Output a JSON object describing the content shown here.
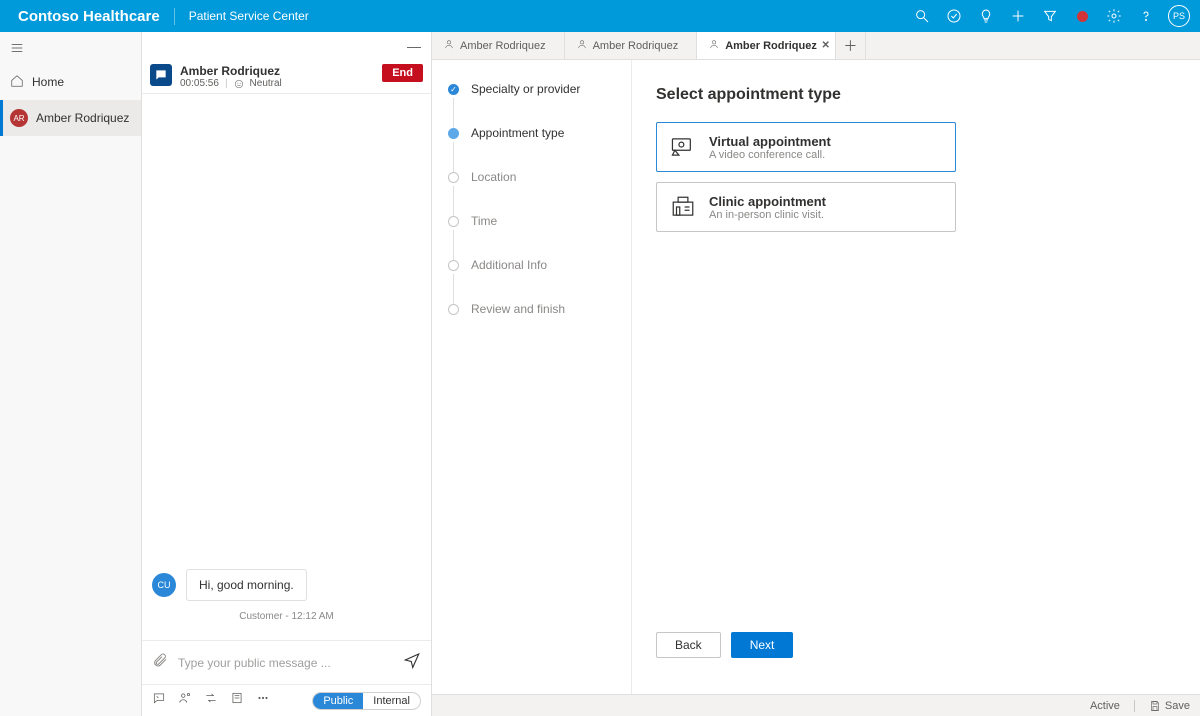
{
  "header": {
    "brand": "Contoso Healthcare",
    "module": "Patient Service Center",
    "avatar_initials": "PS"
  },
  "sidebar": {
    "items": [
      {
        "label": "Home",
        "active": false
      },
      {
        "label": "Amber Rodriquez",
        "active": true,
        "initials": "AR"
      }
    ]
  },
  "conversation": {
    "patient_name": "Amber Rodriquez",
    "duration": "00:05:56",
    "sentiment": "Neutral",
    "end_label": "End",
    "messages": [
      {
        "sender_initials": "CU",
        "text": "Hi, good morning."
      }
    ],
    "meta_line": "Customer - 12:12 AM",
    "composer_placeholder": "Type your public message ...",
    "mode_public": "Public",
    "mode_internal": "Internal"
  },
  "tabs": [
    {
      "label": "Amber Rodriquez",
      "active": false,
      "closable": false
    },
    {
      "label": "Amber Rodriquez",
      "active": false,
      "closable": false
    },
    {
      "label": "Amber Rodriquez",
      "active": true,
      "closable": true
    }
  ],
  "wizard": {
    "steps": [
      {
        "label": "Specialty or provider",
        "state": "done"
      },
      {
        "label": "Appointment type",
        "state": "current"
      },
      {
        "label": "Location",
        "state": "future"
      },
      {
        "label": "Time",
        "state": "future"
      },
      {
        "label": "Additional Info",
        "state": "future"
      },
      {
        "label": "Review and finish",
        "state": "future"
      }
    ]
  },
  "appointment": {
    "heading": "Select appointment type",
    "options": [
      {
        "title": "Virtual appointment",
        "desc": "A video conference call.",
        "selected": true,
        "icon": "virtual"
      },
      {
        "title": "Clinic appointment",
        "desc": "An in-person clinic visit.",
        "selected": false,
        "icon": "clinic"
      }
    ],
    "back_label": "Back",
    "next_label": "Next"
  },
  "statusbar": {
    "state": "Active",
    "save": "Save"
  }
}
